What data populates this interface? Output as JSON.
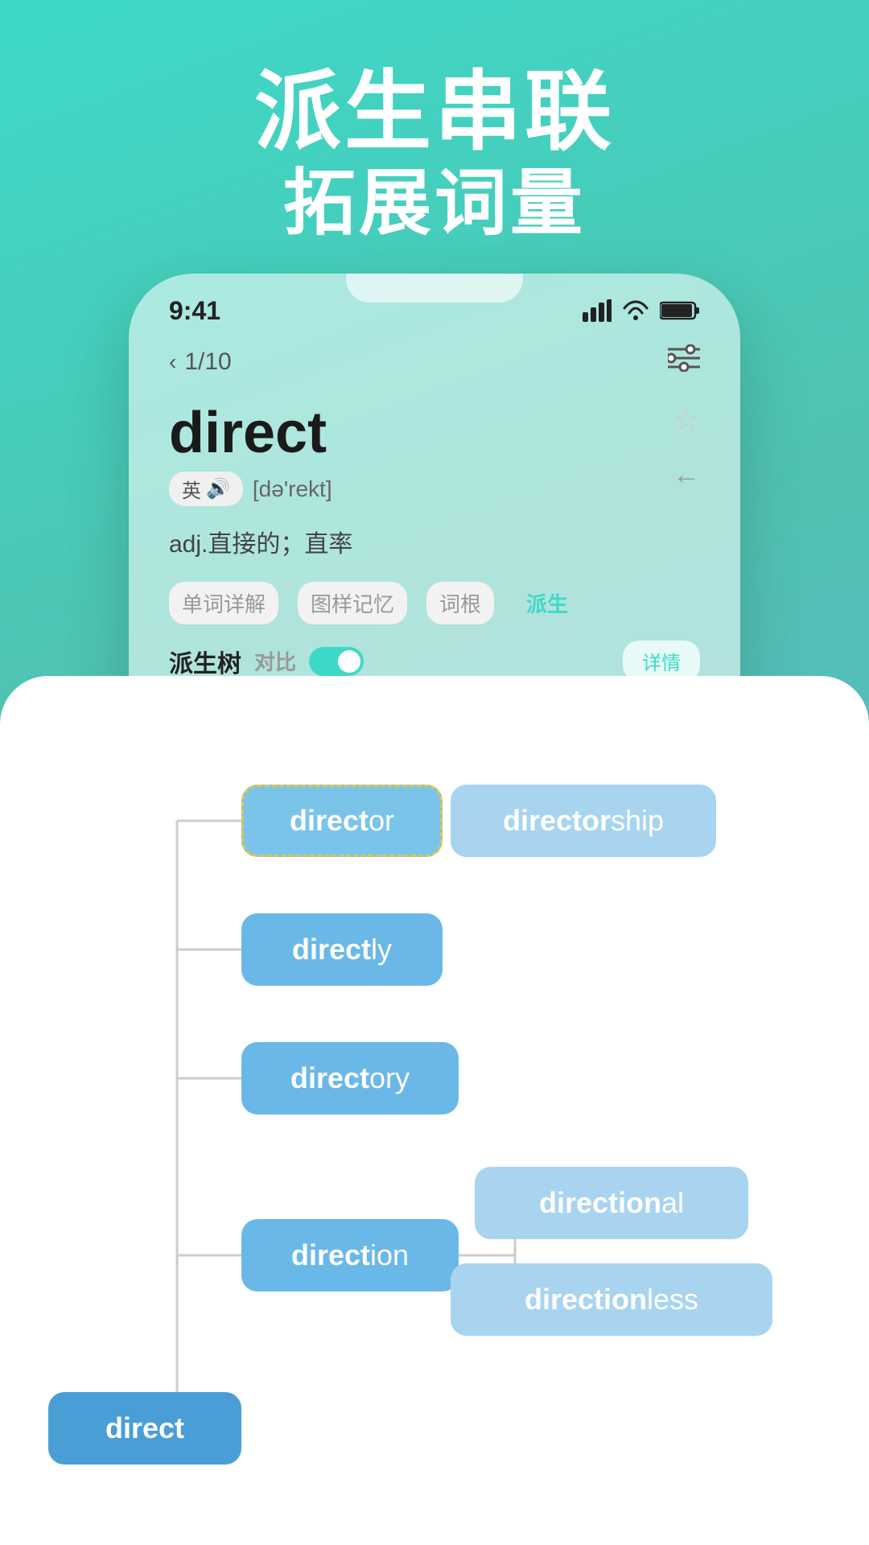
{
  "hero": {
    "line1": "派生串联",
    "line2": "拓展词量"
  },
  "status": {
    "time": "9:41",
    "signal": "▌▌▌",
    "wifi": "wifi",
    "battery": "battery"
  },
  "nav": {
    "page": "1/10",
    "filter_icon": "≡"
  },
  "word": {
    "title": "direct",
    "lang_badge": "英",
    "phonetic": "[də'rekt]",
    "meaning": "adj.直接的；直率"
  },
  "tabs": [
    {
      "label": "单词详解",
      "active": false
    },
    {
      "label": "图样记忆",
      "active": false
    },
    {
      "label": "词根",
      "active": false
    },
    {
      "label": "派生",
      "active": true
    }
  ],
  "tree": {
    "header_label": "派生树",
    "compare_label": "对比",
    "detail_btn": "详情"
  },
  "nodes": {
    "root": "direct",
    "director": "director",
    "directorship": "directorship",
    "directly": "directly",
    "directory": "directory",
    "direction": "direction",
    "directional": "directional",
    "directionless": "directionless"
  }
}
